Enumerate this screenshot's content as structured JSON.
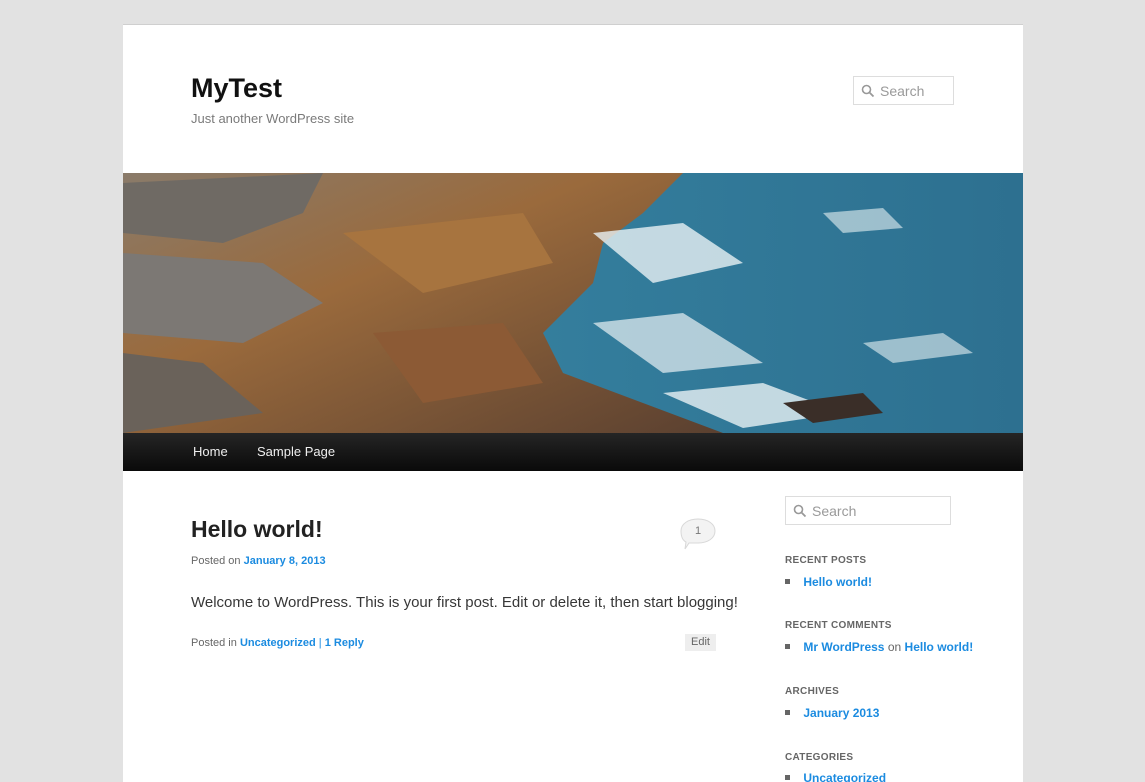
{
  "site": {
    "title": "MyTest",
    "description": "Just another WordPress site"
  },
  "header_search": {
    "placeholder": "Search"
  },
  "header_image": {
    "alt": "Rocky coastline with waves"
  },
  "nav": {
    "items": [
      {
        "label": "Home"
      },
      {
        "label": "Sample Page"
      }
    ]
  },
  "post": {
    "title": "Hello world!",
    "posted_on_prefix": "Posted on",
    "date": "January 8, 2013",
    "comment_count": "1",
    "content": "Welcome to WordPress. This is your first post. Edit or delete it, then start blogging!",
    "posted_in_prefix": "Posted in",
    "category": "Uncategorized",
    "separator": "|",
    "reply_link": "1 Reply",
    "edit_label": "Edit"
  },
  "sidebar": {
    "search_placeholder": "Search",
    "recent_posts": {
      "title": "Recent Posts",
      "items": [
        "Hello world!"
      ]
    },
    "recent_comments": {
      "title": "Recent Comments",
      "author": "Mr WordPress",
      "on_text": "on",
      "post": "Hello world!"
    },
    "archives": {
      "title": "Archives",
      "items": [
        "January 2013"
      ]
    },
    "categories": {
      "title": "Categories",
      "items": [
        "Uncategorized"
      ]
    }
  },
  "colors": {
    "link": "#1b8be0",
    "nav_bg": "#1a1a1a",
    "page_bg": "#e2e2e2"
  }
}
